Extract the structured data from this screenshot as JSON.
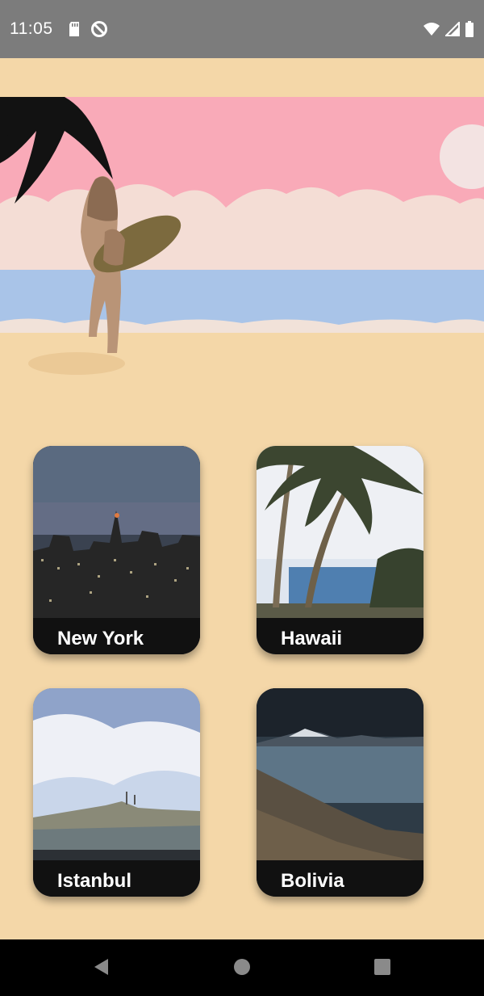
{
  "status_bar": {
    "time": "11:05",
    "left_icons": [
      "sd-card-icon",
      "do-not-disturb-icon"
    ],
    "right_icons": [
      "wifi-icon",
      "cell-signal-icon",
      "battery-icon"
    ]
  },
  "hero": {
    "image": "beach-surfer-illustration",
    "colors": {
      "sky": "#f9aab8",
      "sea": "#a9c4e8",
      "sand": "#f4d7a8",
      "sun": "#f3e3e2",
      "clouds": "#f4ddd5"
    }
  },
  "destinations": [
    {
      "name": "New York",
      "image": "city-skyline-night"
    },
    {
      "name": "Hawaii",
      "image": "palm-trees-beach"
    },
    {
      "name": "Istanbul",
      "image": "city-coast-mosque"
    },
    {
      "name": "Bolivia",
      "image": "mountain-lake"
    }
  ],
  "nav_bar": {
    "buttons": [
      "back-icon",
      "home-icon",
      "recents-icon"
    ]
  }
}
